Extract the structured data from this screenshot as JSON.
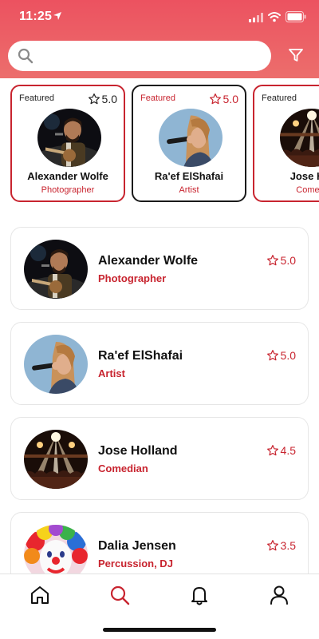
{
  "status_bar": {
    "time": "11:25"
  },
  "search": {
    "placeholder": "",
    "value": ""
  },
  "featured": [
    {
      "tag": "Featured",
      "rating": "5.0",
      "name": "Alexander Wolfe",
      "role": "Photographer",
      "selected": false,
      "avatar": "guitarist-photo"
    },
    {
      "tag": "Featured",
      "rating": "5.0",
      "name": "Ra'ef ElShafai",
      "role": "Artist",
      "selected": true,
      "avatar": "singer-photo"
    },
    {
      "tag": "Featured",
      "rating": "",
      "name": "Jose Ho",
      "role": "Comed",
      "selected": false,
      "avatar": "concert-photo"
    }
  ],
  "list": [
    {
      "name": "Alexander Wolfe",
      "role": "Photographer",
      "rating": "5.0",
      "avatar": "guitarist-photo"
    },
    {
      "name": "Ra'ef ElShafai",
      "role": "Artist",
      "rating": "5.0",
      "avatar": "singer-photo"
    },
    {
      "name": "Jose Holland",
      "role": "Comedian",
      "rating": "4.5",
      "avatar": "concert-photo"
    },
    {
      "name": "Dalia Jensen",
      "role": "Percussion, DJ",
      "rating": "3.5",
      "avatar": "clown-photo"
    }
  ],
  "nav": {
    "items": [
      {
        "icon": "home-icon",
        "active": false
      },
      {
        "icon": "search-icon",
        "active": true
      },
      {
        "icon": "bell-icon",
        "active": false
      },
      {
        "icon": "profile-icon",
        "active": false
      }
    ]
  },
  "colors": {
    "header": "#ec5c64",
    "accent": "#c8242f",
    "selected_border": "#1a1a1a"
  }
}
